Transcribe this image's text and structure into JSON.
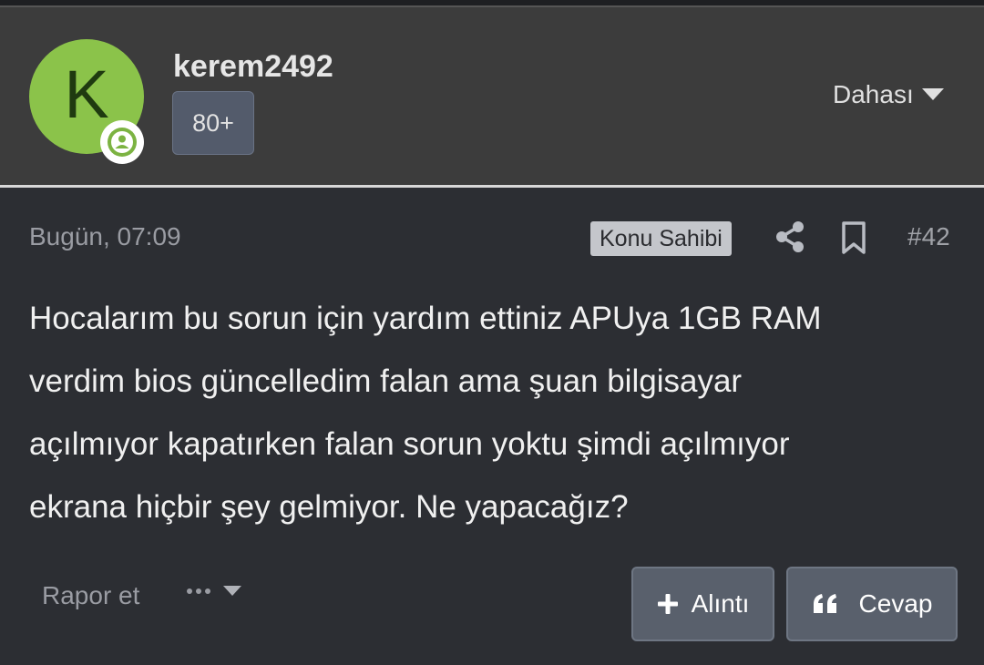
{
  "user": {
    "avatar_letter": "K",
    "username": "kerem2492",
    "rank": "80+",
    "online": true
  },
  "header": {
    "more_label": "Dahası"
  },
  "post": {
    "date": "Bugün, 07:09",
    "owner_badge": "Konu Sahibi",
    "number": "#42",
    "lines": [
      "Hocalarım bu sorun için yardım ettiniz APUya 1GB RAM",
      "verdim bios güncelledim falan ama şuan bilgisayar",
      "açılmıyor kapatırken falan sorun yoktu şimdi açılmıyor",
      "ekrana hiçbir şey gelmiyor. Ne yapacağız?"
    ]
  },
  "actions": {
    "report_label": "Rapor et",
    "quote_label": "Alıntı",
    "reply_label": "Cevap"
  },
  "colors": {
    "avatar_bg": "#8bc34a",
    "header_bg": "#3c3c3c",
    "page_bg": "#2c2e33",
    "button_bg": "#59606c"
  },
  "icons": {
    "share": "share-icon",
    "bookmark": "bookmark-icon",
    "online": "online-user-icon",
    "more": "chevron-down-icon",
    "plus": "plus-icon",
    "quote": "quote-icon",
    "dots": "ellipsis-icon"
  }
}
